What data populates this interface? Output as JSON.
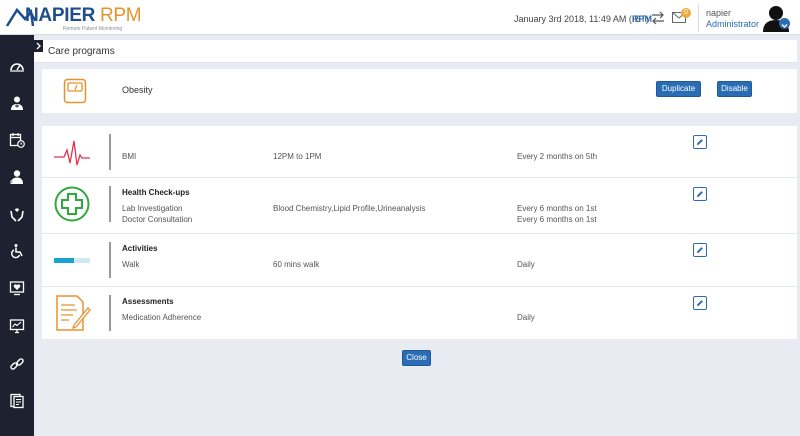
{
  "brand": {
    "name": "NAPIER",
    "product": "RPM",
    "tagline": "Remote Patient Monitoring"
  },
  "header": {
    "datetime": "January 3rd 2018, 11:49 AM (IST)",
    "rpm_link": "RPM",
    "mail_count": "0",
    "user_name": "napier",
    "user_role": "Administrator"
  },
  "sidebar": {
    "items": [
      {
        "icon": "dashboard-icon"
      },
      {
        "icon": "doctor-icon"
      },
      {
        "icon": "calendar-clock-icon"
      },
      {
        "icon": "patient-icon"
      },
      {
        "icon": "care-hands-icon"
      },
      {
        "icon": "wheelchair-icon"
      },
      {
        "icon": "heart-monitor-icon"
      },
      {
        "icon": "desktop-chart-icon"
      },
      {
        "icon": "link-icon"
      },
      {
        "icon": "reports-icon"
      }
    ]
  },
  "page": {
    "title": "Care programs"
  },
  "program": {
    "name": "Obesity",
    "duplicate_label": "Duplicate",
    "disable_label": "Disable"
  },
  "items": [
    {
      "icon": "heartbeat-icon",
      "title": "",
      "rows": [
        {
          "name": "BMI",
          "detail": "12PM to 1PM",
          "frequency": "Every 2 months on 5th"
        }
      ]
    },
    {
      "icon": "health-cross-icon",
      "title": "Health Check-ups",
      "rows": [
        {
          "name": "Lab Investigation",
          "detail": "Blood Chemistry,Lipid Profile,Urineanalysis",
          "frequency": "Every 6 months on 1st"
        },
        {
          "name": "Doctor Consultation",
          "detail": "",
          "frequency": "Every 6 months on 1st"
        }
      ]
    },
    {
      "icon": "progress-bar-icon",
      "title": "Activities",
      "rows": [
        {
          "name": "Walk",
          "detail": "60 mins walk",
          "frequency": "Daily"
        }
      ]
    },
    {
      "icon": "assessment-icon",
      "title": "Assessments",
      "rows": [
        {
          "name": "Medication Adherence",
          "detail": "",
          "frequency": "Daily"
        }
      ]
    }
  ],
  "close_label": "Close",
  "colors": {
    "primary": "#2a6db5",
    "sidebar": "#1e2230",
    "accent_orange": "#e8922c",
    "accent_green": "#2eaa3a",
    "accent_red": "#e0334d",
    "accent_cyan": "#1aa3d0"
  }
}
